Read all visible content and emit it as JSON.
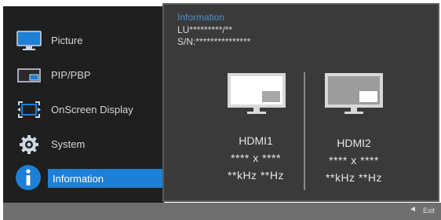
{
  "menu": {
    "items": [
      {
        "label": "Picture",
        "icon": "monitor-icon"
      },
      {
        "label": "PIP/PBP",
        "icon": "pip-pbp-icon"
      },
      {
        "label": "OnScreen Display",
        "icon": "onscreen-display-icon"
      },
      {
        "label": "System",
        "icon": "gear-icon"
      },
      {
        "label": "Information",
        "icon": "info-icon",
        "selected": true
      }
    ]
  },
  "info": {
    "title": "Information",
    "model": "LU*********/**",
    "serial": "S/N:***************",
    "sources": [
      {
        "name": "HDMI1",
        "resolution": "**** x ****",
        "frequency": "**kHz **Hz"
      },
      {
        "name": "HDMI2",
        "resolution": "**** x ****",
        "frequency": "**kHz **Hz"
      }
    ]
  },
  "footer": {
    "back_arrow": "◄",
    "exit_label": "Exit"
  },
  "colors": {
    "menu_bg": "#1f1f1f",
    "panel_bg": "#3a3a3a",
    "highlight": "#1e7fd6",
    "title_blue": "#4b8fd0",
    "footer_bg": "#6f6f6f"
  }
}
